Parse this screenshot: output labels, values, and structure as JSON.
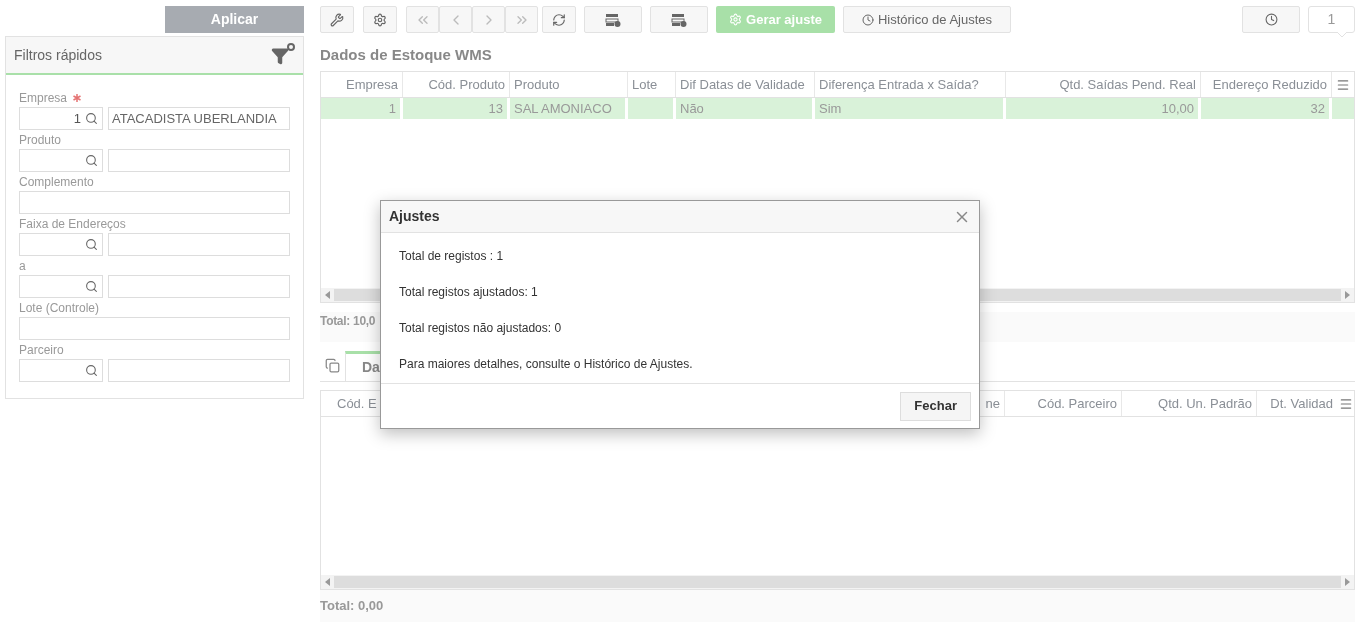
{
  "toolbar": {
    "apply_button": "Aplicar",
    "generate_button": "Gerar ajuste",
    "history_button": "Histórico de Ajustes",
    "counter": "1"
  },
  "filters": {
    "title": "Filtros rápidos",
    "fields": [
      {
        "kind": "lookup",
        "label": "Empresa",
        "required": true,
        "code": "1",
        "description": "ATACADISTA UBERLANDIA"
      },
      {
        "kind": "lookup",
        "label": "Produto",
        "required": false
      },
      {
        "kind": "text",
        "label": "Complemento",
        "required": false
      },
      {
        "kind": "lookup",
        "label": "Faixa de Endereços",
        "required": false
      },
      {
        "kind": "lookup",
        "label": "a",
        "required": false
      },
      {
        "kind": "text",
        "label": "Lote (Controle)",
        "required": false
      },
      {
        "kind": "lookup",
        "label": "Parceiro",
        "required": false
      }
    ]
  },
  "stock_grid": {
    "title": "Dados de Estoque WMS",
    "columns": [
      "Empresa",
      "Cód. Produto",
      "Produto",
      "Lote",
      "Dif Datas de Validade",
      "Diferença Entrada x Saída?",
      "Qtd. Saídas Pend. Real",
      "Endereço Reduzido"
    ],
    "rows": [
      {
        "selected": true,
        "cells": [
          "1",
          "13",
          "SAL AMONIACO",
          "",
          "Não",
          "Sim",
          "10,00",
          "32"
        ]
      }
    ],
    "total": "Total: 10,0"
  },
  "detail": {
    "tab": "Da",
    "columns": [
      "Cód. E",
      "ne",
      "Cód. Parceiro",
      "Qtd. Un. Padrão",
      "Dt. Validad"
    ],
    "total": "Total: 0,00"
  },
  "dialog": {
    "title": "Ajustes",
    "lines": [
      "Total de registos : 1",
      "Total registos ajustados: 1",
      "Total registos não ajustados: 0",
      "Para maiores detalhes, consulte o Histórico de Ajustes."
    ],
    "close_button": "Fechar"
  }
}
